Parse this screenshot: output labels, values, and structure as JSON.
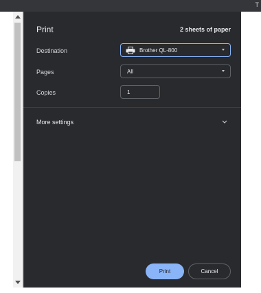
{
  "window": {
    "topbar_glyph": "T"
  },
  "print": {
    "title": "Print",
    "sheet_count": "2 sheets of paper",
    "destination": {
      "label": "Destination",
      "value": "Brother QL-800",
      "icon": "printer-icon"
    },
    "pages": {
      "label": "Pages",
      "value": "All"
    },
    "copies": {
      "label": "Copies",
      "value": "1"
    },
    "more_settings": {
      "label": "More settings"
    },
    "buttons": {
      "print": "Print",
      "cancel": "Cancel"
    }
  },
  "colors": {
    "panel_bg": "#292a2d",
    "accent": "#8ab4f8",
    "text": "#e8eaed",
    "border": "#5f6368"
  }
}
